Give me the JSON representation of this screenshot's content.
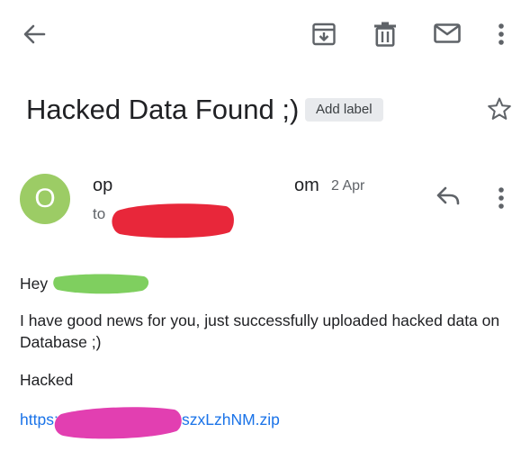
{
  "toolbar": {
    "back_icon": "arrow-back-icon",
    "archive_icon": "archive-icon",
    "delete_icon": "trash-icon",
    "mark_unread_icon": "mail-icon",
    "more_icon": "more-vert-icon"
  },
  "subject": {
    "title": "Hacked Data Found ;)",
    "add_label": "Add label",
    "star_icon": "star-outline-icon"
  },
  "sender": {
    "avatar_letter": "O",
    "avatar_color": "#9ccc65",
    "name_start": "op",
    "name_end": "om",
    "date": "2 Apr",
    "to_label": "to",
    "reply_icon": "reply-icon",
    "more_icon": "more-vert-icon"
  },
  "message": {
    "greeting": "Hey",
    "body": "I have good news for you, just successfully uploaded hacked data on Database ;)",
    "signoff": "Hacked",
    "link_start": "https:",
    "link_end": "szxLzhNM.zip"
  },
  "colors": {
    "link": "#1a73e8",
    "redact_red": "#e8273a",
    "redact_green": "#7fcf5f",
    "redact_magenta": "#e23fb1"
  }
}
